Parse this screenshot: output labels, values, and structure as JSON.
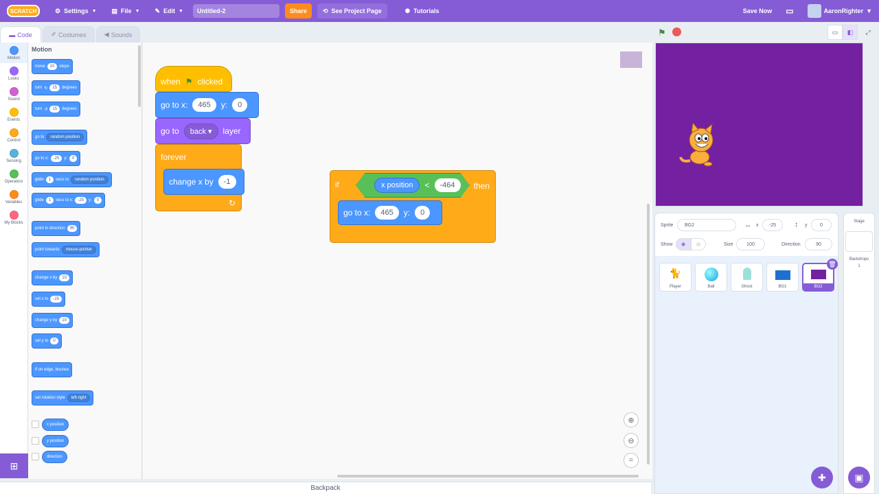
{
  "menubar": {
    "logo": "SCRATCH",
    "settings": "Settings",
    "file": "File",
    "edit": "Edit",
    "project_title": "Untitled-2",
    "share": "Share",
    "see_project_page": "See Project Page",
    "tutorials": "Tutorials",
    "save_now": "Save Now",
    "username": "AaronRighter"
  },
  "tabs": {
    "code": "Code",
    "costumes": "Costumes",
    "sounds": "Sounds"
  },
  "categories": [
    "Motion",
    "Looks",
    "Sound",
    "Events",
    "Control",
    "Sensing",
    "Operators",
    "Variables",
    "My Blocks"
  ],
  "category_colors": [
    "#4c97ff",
    "#9966ff",
    "#cf63cf",
    "#ffbf00",
    "#ffab19",
    "#5cb1d6",
    "#59c059",
    "#ff8c1a",
    "#ff6680"
  ],
  "palette": {
    "title": "Motion",
    "move": {
      "a": "move",
      "v": "10",
      "b": "steps"
    },
    "turn_right": {
      "a": "turn",
      "v": "15",
      "b": "degrees"
    },
    "turn_left": {
      "a": "turn",
      "v": "15",
      "b": "degrees"
    },
    "goto_random": {
      "a": "go to",
      "dd": "random position"
    },
    "goto_xy": {
      "a": "go to x:",
      "x": "-25",
      "b": "y:",
      "y": "0"
    },
    "glide_random": {
      "a": "glide",
      "v": "1",
      "b": "secs to",
      "dd": "random position"
    },
    "glide_xy": {
      "a": "glide",
      "v": "1",
      "b": "secs to x:",
      "x": "-25",
      "c": "y:",
      "y": "0"
    },
    "point_dir": {
      "a": "point in direction",
      "v": "90"
    },
    "point_towards": {
      "a": "point towards",
      "dd": "mouse-pointer"
    },
    "change_x": {
      "a": "change x by",
      "v": "10"
    },
    "set_x": {
      "a": "set x to",
      "v": "-25"
    },
    "change_y": {
      "a": "change y by",
      "v": "10"
    },
    "set_y": {
      "a": "set y to",
      "v": "0"
    },
    "bounce": "if on edge, bounce",
    "rot_style": {
      "a": "set rotation style",
      "dd": "left-right"
    },
    "x_position": "x position",
    "y_position": "y position",
    "direction": "direction"
  },
  "script1": {
    "hat": {
      "a": "when",
      "b": "clicked"
    },
    "goto": {
      "a": "go to x:",
      "x": "465",
      "b": "y:",
      "y": "0"
    },
    "layer": {
      "a": "go to",
      "dd": "back",
      "b": "layer"
    },
    "forever": "forever",
    "change": {
      "a": "change x by",
      "v": "-1"
    }
  },
  "script2": {
    "if": "if",
    "then": "then",
    "reporter": "x position",
    "lt": "<",
    "value": "-464",
    "goto": {
      "a": "go to x:",
      "x": "465",
      "b": "y:",
      "y": "0"
    }
  },
  "backpack": "Backpack",
  "sprite_info": {
    "sprite_label": "Sprite",
    "sprite_name": "BG2",
    "x_label": "x",
    "x": "-25",
    "y_label": "y",
    "y": "0",
    "show_label": "Show",
    "size_label": "Size",
    "size": "100",
    "direction_label": "Direction",
    "direction": "90"
  },
  "sprites": [
    "Player",
    "Ball",
    "Ghost",
    "BG1",
    "BG2"
  ],
  "stage_panel": {
    "title": "Stage",
    "backdrops_label": "Backdrops",
    "backdrops_count": "1"
  }
}
